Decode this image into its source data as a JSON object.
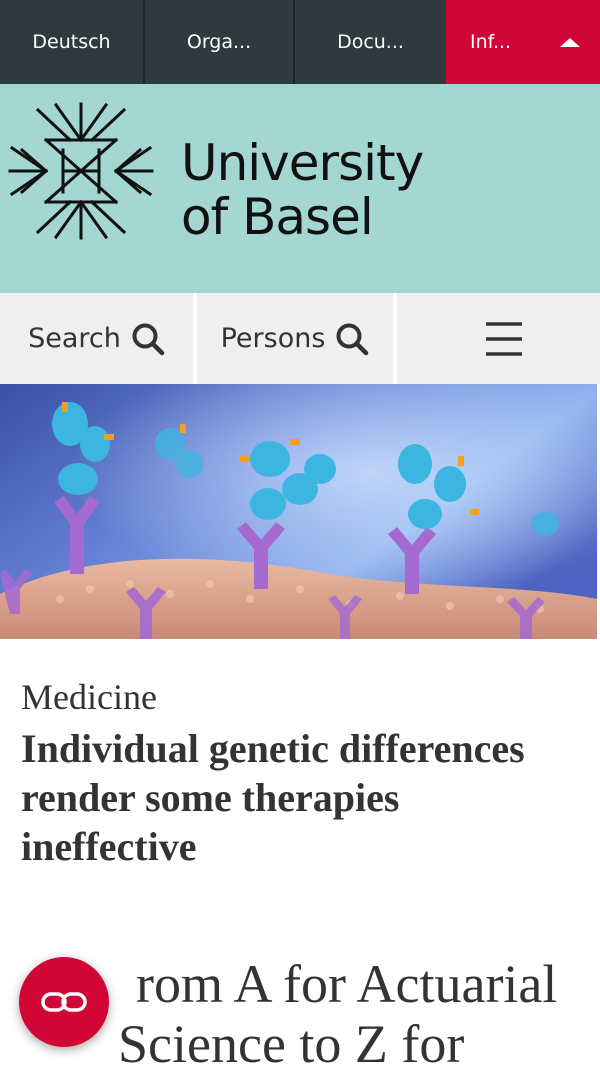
{
  "topnav": {
    "items": [
      {
        "label": "Deutsch"
      },
      {
        "label": "Orga..."
      },
      {
        "label": "Docu..."
      },
      {
        "label": "Inf..."
      }
    ],
    "active_color": "#d20537",
    "bg_color": "#2f3a3e"
  },
  "logo": {
    "line1": "University",
    "line2": "of Basel",
    "band_color": "#a5d7d2"
  },
  "utility": {
    "search_label": "Search",
    "persons_label": "Persons",
    "icons": [
      "search-icon",
      "search-icon",
      "menu-icon"
    ]
  },
  "article": {
    "category": "Medicine",
    "headline": "Individual genetic differences render some therapies ineffective"
  },
  "teaser": {
    "line1": "rom A for Actuarial",
    "line2": "Science to Z for"
  },
  "fab": {
    "icon": "link-icon",
    "color": "#d20537"
  }
}
